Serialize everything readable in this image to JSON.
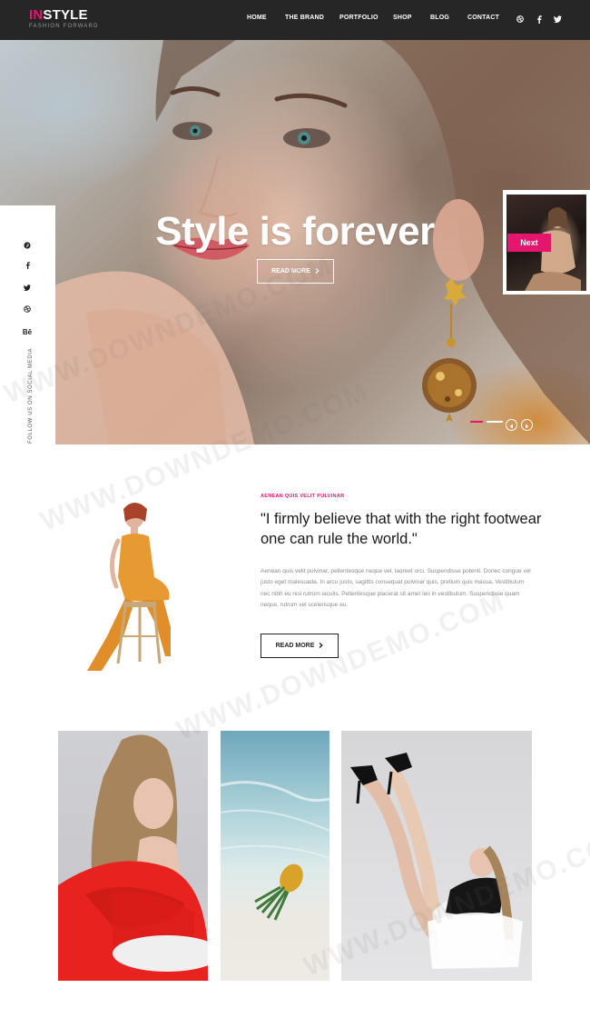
{
  "header": {
    "logo_accent": "IN",
    "logo_rest": "STYLE",
    "tagline": "FASHION FORWARD",
    "nav": [
      "HOME",
      "THE BRAND",
      "PORTFOLIO",
      "SHOP",
      "BLOG",
      "CONTACT"
    ],
    "social_icons": [
      "dribbble-icon",
      "facebook-icon",
      "twitter-icon"
    ]
  },
  "hero": {
    "title": "Style is forever",
    "button_label": "READ MORE",
    "next_label": "Next"
  },
  "sidebar": {
    "icons": [
      "pinterest-icon",
      "facebook-icon",
      "twitter-icon",
      "dribbble-icon",
      "behance-icon"
    ],
    "behance_text": "Bē",
    "follow_text": "FOLLOW US ON SOCIAL MEDIA"
  },
  "about": {
    "eyebrow": "AENEAN QUIS VELIT PULVINAR",
    "quote": "\"I firmly believe that with the right footwear one can rule the world.\"",
    "body": "Aenean quis velit pulvinar, pellentesque neque vel, laoreet orci. Suspendisse potenti. Donec congue vel justo eget malesuada. In arcu justo, sagittis consequat pulvinar quis, pretium quis massa. Vestibulum nec nibh eu nisi rutrum iaculis. Pellentesque placerat sit amet leo in vestibulum. Suspendisse quam neque, rutrum vel scelerisque eu.",
    "button_label": "READ MORE"
  },
  "watermark": "WWW.DOWNDEMO.COM",
  "colors": {
    "accent": "#e6166f",
    "header_bg": "#262626"
  }
}
